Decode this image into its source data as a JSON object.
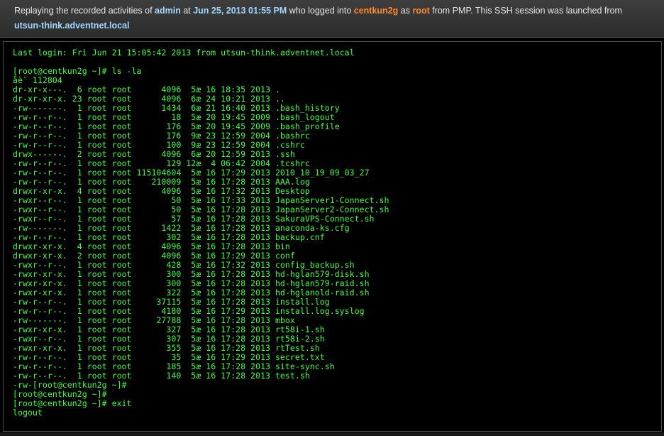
{
  "header": {
    "prefix": "Replaying the recorded activities of ",
    "user": "admin",
    "at_label": " at ",
    "datetime": "Jun 25, 2013 01:55 PM",
    "logged_into_label": " who logged into ",
    "host": "centkun2g",
    "as_label": " as ",
    "account": "root",
    "launched_label": " from PMP. This SSH session was launched from ",
    "source_host": "utsun-think.adventnet.local"
  },
  "colors": {
    "terminal_text": "#3aff3a",
    "terminal_bg": "#000000",
    "header_bg": "#333333",
    "highlight_blue": "#9fd6ff",
    "highlight_orange": "#ff8a2a"
  },
  "terminal": {
    "lines": [
      "Last login: Fri Jun 21 15:05:42 2013 from utsun-think.adventnet.local",
      "",
      "[root@centkun2g ~]# ls -la",
      "åè¨ 112804",
      "dr-xr-x---.  6 root root      4096  5æ 16 18:35 2013 .",
      "dr-xr-xr-x. 23 root root      4096  6æ 24 10:21 2013 ..",
      "-rw-------.  1 root root      1434  6æ 21 16:40 2013 .bash_history",
      "-rw-r--r--.  1 root root        18  5æ 20 19:45 2009 .bash_logout",
      "-rw-r--r--.  1 root root       176  5æ 20 19:45 2009 .bash_profile",
      "-rw-r--r--.  1 root root       176  9æ 23 12:59 2004 .bashrc",
      "-rw-r--r--.  1 root root       100  9æ 23 12:59 2004 .cshrc",
      "drwx------.  2 root root      4096  6æ 20 12:59 2013 .ssh",
      "-rw-r--r--.  1 root root       129 12æ  4 06:42 2004 .tcshrc",
      "-rw-r--r--.  1 root root 115104604  5æ 16 17:29 2013 2010_10_19_09_03_27",
      "-rw-r--r--.  1 root root    210009  5æ 16 17:28 2013 AAA.log",
      "drwxr-xr-x.  4 root root      4096  5æ 16 17:32 2013 Desktop",
      "-rwxr--r--.  1 root root        50  5æ 16 17:33 2013 JapanServer1-Connect.sh",
      "-rwxr--r--.  1 root root        50  5æ 16 17:28 2013 JapanServer2-Connect.sh",
      "-rwxr--r--.  1 root root        57  5æ 16 17:28 2013 SakuraVPS-Connect.sh",
      "-rw-------.  1 root root      1422  5æ 16 17:28 2013 anaconda-ks.cfg",
      "-rw-r--r--.  1 root root       302  5æ 16 17:28 2013 backup.cnf",
      "drwxr-xr-x.  4 root root      4096  5æ 16 17:28 2013 bin",
      "drwxr-xr-x.  2 root root      4096  5æ 16 17:29 2013 conf",
      "-rwxr--r--.  1 root root       428  5æ 16 17:32 2013 config_backup.sh",
      "-rwxr-xr-x.  1 root root       300  5æ 16 17:28 2013 hd-hglan579-disk.sh",
      "-rwxr-xr-x.  1 root root       300  5æ 16 17:28 2013 hd-hglan579-raid.sh",
      "-rwxr-xr-x.  1 root root       322  5æ 16 17:28 2013 hd-hglanold-raid.sh",
      "-rw-r--r--.  1 root root     37115  5æ 16 17:28 2013 install.log",
      "-rw-r--r--.  1 root root      4180  5æ 16 17:29 2013 install.log.syslog",
      "-rw-------.  1 root root     27788  5æ 16 17:28 2013 mbox",
      "-rwxr-xr-x.  1 root root       327  5æ 16 17:28 2013 rt58i-1.sh",
      "-rwxr--r--.  1 root root       307  5æ 16 17:28 2013 rt58i-2.sh",
      "-rwxr-xr-x.  1 root root       355  5æ 16 17:28 2013 rtTest.sh",
      "-rw-r--r--.  1 root root        35  5æ 16 17:29 2013 secret.txt",
      "-rw-r--r--.  1 root root       185  5æ 16 17:28 2013 site-sync.sh",
      "-rw-r--r--.  1 root root       140  5æ 16 17:28 2013 test.sh",
      "-rw-[root@centkun2g ~]#",
      "[root@centkun2g ~]#",
      "[root@centkun2g ~]# exit",
      "logout"
    ]
  }
}
